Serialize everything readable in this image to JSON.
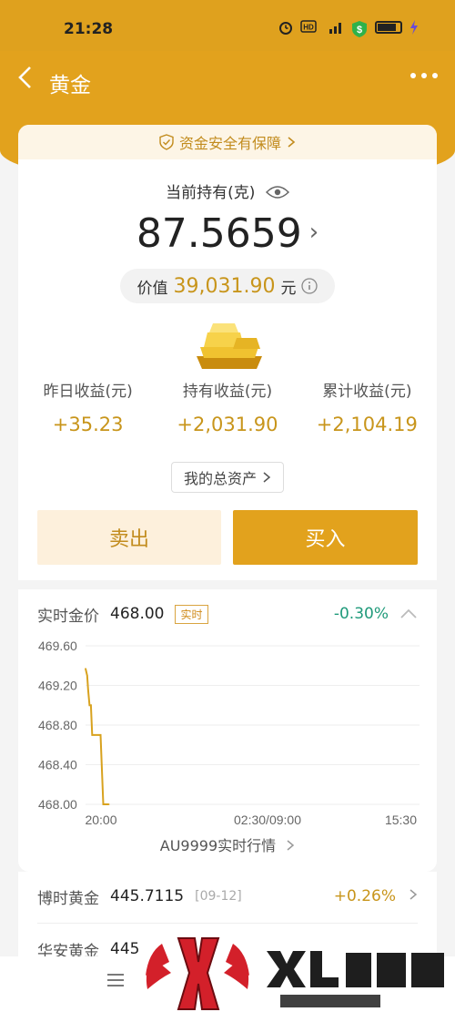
{
  "status_bar": {
    "time": "21:28",
    "battery_level": 0.75
  },
  "header": {
    "back_icon": "chevron-left-icon",
    "title": "黄金",
    "more_icon": "more-dots-icon"
  },
  "safety_banner": {
    "text": "资金安全有保障",
    "icon": "shield-check-icon"
  },
  "holding": {
    "label": "当前持有(克)",
    "amount": "87.5659",
    "value_label": "价值",
    "value_amount": "39,031.90",
    "value_unit": "元"
  },
  "stats": [
    {
      "label": "昨日收益(元)",
      "value": "+35.23"
    },
    {
      "label": "持有收益(元)",
      "value": "+2,031.90"
    },
    {
      "label": "累计收益(元)",
      "value": "+2,104.19"
    }
  ],
  "total_assets_label": "我的总资产",
  "actions": {
    "sell": "卖出",
    "buy": "买入"
  },
  "realtime": {
    "label": "实时金价",
    "price": "468.00",
    "badge": "实时",
    "change": "-0.30%"
  },
  "chart_data": {
    "type": "line",
    "x_ticks": [
      "20:00",
      "02:30/09:00",
      "15:30"
    ],
    "y_ticks": [
      "469.60",
      "469.20",
      "468.80",
      "468.40",
      "468.00"
    ],
    "ylim": [
      468.0,
      469.6
    ],
    "x_range": [
      0,
      100
    ],
    "x": [
      0,
      0.5,
      0.8,
      1.2,
      1.6,
      2.0,
      2.5,
      4.0,
      4.5,
      5.3,
      6.0,
      7.0
    ],
    "y": [
      469.37,
      469.3,
      469.15,
      469.0,
      469.0,
      468.7,
      468.7,
      468.7,
      468.7,
      468.0,
      468.0,
      468.0
    ],
    "color": "#d8a21f",
    "grid": true
  },
  "market_link": "AU9999实时行情",
  "funds": [
    {
      "name": "博时黄金",
      "nav": "445.7115",
      "date": "[09-12]",
      "change": "+0.26%"
    },
    {
      "name": "华安黄金",
      "nav": "445"
    }
  ],
  "colors": {
    "brand": "#e2a21d",
    "gold_text": "#c8951b",
    "down": "#1f9a7a"
  }
}
